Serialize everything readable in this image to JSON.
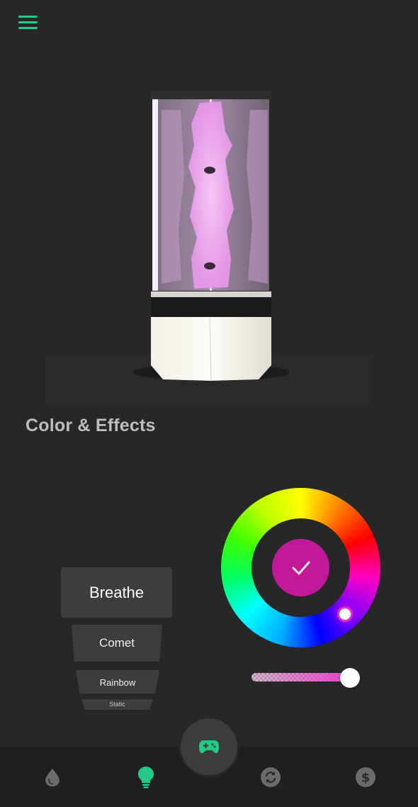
{
  "theme": {
    "accent": "#22c987",
    "selected_color": "#c01899",
    "inactive_icon": "#6b6b6b"
  },
  "header": {
    "menu_icon": "hamburger-menu-icon"
  },
  "section": {
    "title": "Color & Effects"
  },
  "effects": {
    "items": [
      {
        "label": "Breathe",
        "selected": true
      },
      {
        "label": "Comet",
        "selected": false
      },
      {
        "label": "Rainbow",
        "selected": false
      },
      {
        "label": "Static",
        "selected": false
      }
    ]
  },
  "color_picker": {
    "selected_hex": "#c01899",
    "confirm_icon": "checkmark-icon",
    "brightness_percent": 95
  },
  "nav": {
    "items": [
      {
        "icon": "water-drop-icon",
        "active": false
      },
      {
        "icon": "light-bulb-icon",
        "active": true
      },
      {
        "icon": "sync-icon",
        "active": false
      },
      {
        "icon": "dollar-icon",
        "active": false
      }
    ],
    "center_button_icon": "gamepad-icon"
  }
}
